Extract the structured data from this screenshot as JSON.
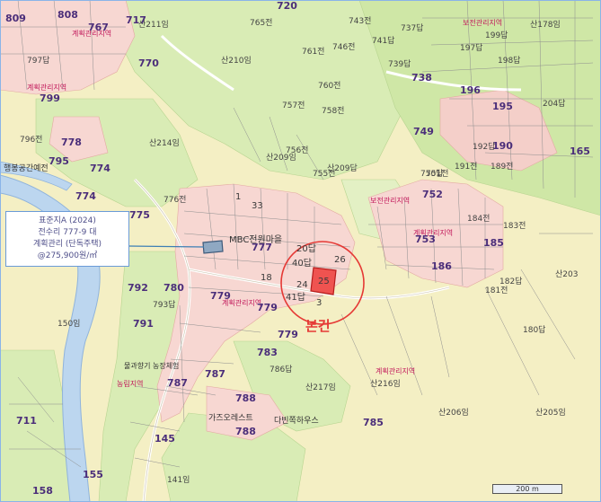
{
  "legend": {
    "line1": "표준지A (2024)",
    "line2": "전수리 777-9 대",
    "line3": "계획관리 (단독주택)",
    "line4": "@275,900원/㎡"
  },
  "subject": {
    "label": "본건"
  },
  "scale": {
    "label": "200 m"
  },
  "zones": {
    "z1": "계획관리지역",
    "z2": "계획관리지역",
    "z3": "계획관리지역",
    "z4": "보전관리지역",
    "z5": "계획관리지역",
    "z6": "계획관리지역",
    "z7": "보전관리지역",
    "z8": "농림지역"
  },
  "places": {
    "p1": "행봉공간예전",
    "p2": "MBC전원마을",
    "p3": "물과향기 농장체험",
    "p4": "다빈쪽하우스",
    "p5": "가즈오레스트"
  },
  "lots": {
    "l720": "720",
    "l717": "717",
    "l808": "808",
    "l809": "809",
    "l767": "767",
    "l770": "770",
    "l799": "799",
    "l778": "778",
    "l795": "795",
    "l774": "774",
    "l774b": "774",
    "l775": "775",
    "l792": "792",
    "l780": "780",
    "l791": "791",
    "l779": "779",
    "l777": "777",
    "l779b": "779",
    "l779c": "779",
    "l783": "783",
    "l787": "787",
    "l787b": "787",
    "l788": "788",
    "l788b": "788",
    "l785": "785",
    "l711": "711",
    "l145": "145",
    "l155": "155",
    "l158": "158",
    "l738": "738",
    "l196": "196",
    "l195": "195",
    "l749": "749",
    "l190": "190",
    "l165": "165",
    "l753": "753",
    "l185": "185",
    "l186": "186",
    "l752": "752",
    "s210": "산210임",
    "s214": "산214임",
    "s209": "산209임",
    "s209b": "산209답",
    "s203": "산203",
    "s206": "산206임",
    "s205": "산205임",
    "s216": "산216임",
    "s217": "산217임",
    "s211": "산211임",
    "s178": "산178임",
    "s150": "150임",
    "s141": "141임",
    "d776": "776전",
    "d757": "757전",
    "d756": "756전",
    "d755": "755전",
    "d751": "751전",
    "d765": "765전",
    "d761": "761전",
    "d760": "760전",
    "d758": "758전",
    "d746": "746전",
    "d743": "743전",
    "d741": "741답",
    "d737": "737답",
    "d739": "739답",
    "d750": "750답",
    "d191": "191전",
    "d189": "189전",
    "d192": "192답",
    "d197": "197답",
    "d198": "198답",
    "d199": "199답",
    "d204": "204답",
    "d181": "181전",
    "d182": "182답",
    "d180": "180답",
    "d184": "184전",
    "d183": "183전",
    "d793": "793답",
    "d796": "796전",
    "d797": "797답",
    "d786": "786답",
    "n40": "40답",
    "n41": "41답",
    "n20": "20답",
    "n24": "24",
    "n25": "25",
    "n26": "26",
    "n3": "3",
    "n18": "18",
    "n33": "33",
    "n1": "1"
  }
}
